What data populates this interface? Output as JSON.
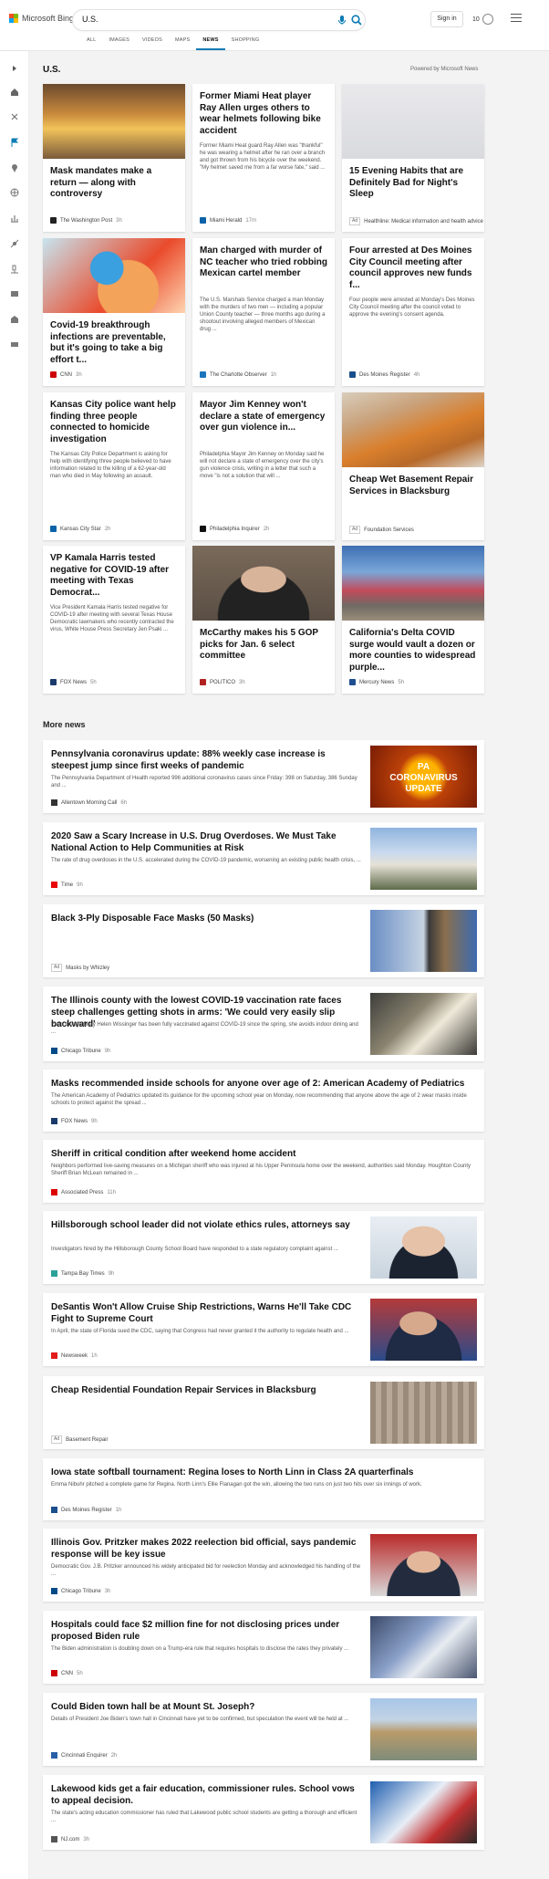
{
  "header": {
    "logo_text": "Microsoft Bing",
    "search_query": "U.S.",
    "sign_in": "Sign in",
    "rewards_points": "10",
    "tabs": [
      {
        "label": "ALL",
        "active": false
      },
      {
        "label": "IMAGES",
        "active": false
      },
      {
        "label": "VIDEOS",
        "active": false
      },
      {
        "label": "MAPS",
        "active": false
      },
      {
        "label": "NEWS",
        "active": true
      },
      {
        "label": "SHOPPING",
        "active": false
      }
    ],
    "accent": "#0c7bb5"
  },
  "sidebar_icons": [
    "expand-icon",
    "home-icon",
    "discover-icon",
    "flag-icon",
    "location-icon",
    "globe-icon",
    "chart-icon",
    "science-icon",
    "microscope-icon",
    "video-icon",
    "building-icon",
    "money-icon"
  ],
  "section": {
    "title": "U.S.",
    "powered_by": "Powered by Microsoft News"
  },
  "cards": [
    {
      "title": "Mask mandates make a return — along with controversy",
      "snippet": "",
      "source": "The Washington Post",
      "age": "3h",
      "ad": false
    },
    {
      "title": "Former Miami Heat player Ray Allen urges others to wear helmets following bike accident",
      "snippet": "Former Miami Heat guard Ray Allen was \"thankful\" he was wearing a helmet after he ran over a branch and got thrown from his bicycle over the weekend. \"My helmet saved me from a far worse fate,\" said ...",
      "source": "Miami Herald",
      "age": "17m",
      "ad": false
    },
    {
      "title": "15 Evening Habits that are Definitely Bad for Night's Sleep",
      "snippet": "",
      "source": "Healthline: Medical information and health advice",
      "age": "",
      "ad": true
    },
    {
      "title": "Covid-19 breakthrough infections are preventable, but it's going to take a big effort t...",
      "snippet": "",
      "source": "CNN",
      "age": "3h",
      "ad": false
    },
    {
      "title": "Man charged with murder of NC teacher who tried robbing Mexican cartel member",
      "snippet": "The U.S. Marshals Service charged a man Monday with the murders of two men — including a popular Union County teacher — three months ago during a shootout involving alleged members of Mexican drug ...",
      "source": "The Charlotte Observer",
      "age": "1h",
      "ad": false
    },
    {
      "title": "Four arrested at Des Moines City Council meeting after council approves new funds f...",
      "snippet": "Four people were arrested at Monday's Des Moines City Council meeting after the council voted to approve the evening's consent agenda.",
      "source": "Des Moines Register",
      "age": "4h",
      "ad": false
    },
    {
      "title": "Kansas City police want help finding three people connected to homicide investigation",
      "snippet": "The Kansas City Police Department is asking for help with identifying three people believed to have information related to the killing of a 62-year-old man who died in May following an assault.",
      "source": "Kansas City Star",
      "age": "2h",
      "ad": false
    },
    {
      "title": "Mayor Jim Kenney won't declare a state of emergency over gun violence in...",
      "snippet": "Philadelphia Mayor Jim Kenney on Monday said he will not declare a state of emergency over the city's gun violence crisis, writing in a letter that such a move \"is not a solution that will ...",
      "source": "Philadelphia Inquirer",
      "age": "2h",
      "ad": false
    },
    {
      "title": "Cheap Wet Basement Repair Services in Blacksburg",
      "snippet": "",
      "source": "Foundation Services",
      "age": "",
      "ad": true
    },
    {
      "title": "VP Kamala Harris tested negative for COVID-19 after meeting with Texas Democrat...",
      "snippet": "Vice President Kamala Harris tested negative for COVID-19 after meeting with several Texas House Democratic lawmakers who recently contracted the virus, White House Press Secretary Jen Psaki ...",
      "source": "FOX News",
      "age": "5h",
      "ad": false
    },
    {
      "title": "McCarthy makes his 5 GOP picks for Jan. 6 select committee",
      "snippet": "",
      "source": "POLITICO",
      "age": "3h",
      "ad": false
    },
    {
      "title": "California's Delta COVID surge would vault a dozen or more counties to widespread purple...",
      "snippet": "",
      "source": "Mercury News",
      "age": "5h",
      "ad": false
    }
  ],
  "more_news": {
    "title": "More news",
    "items": [
      {
        "title": "Pennsylvania coronavirus update: 88% weekly case increase is steepest jump since first weeks of pandemic",
        "snippet": "The Pennsylvania Department of Health reported 996 additional coronavirus cases since Friday: 398 on Saturday, 386 Sunday and ...",
        "source": "Allentown Morning Call",
        "age": "6h",
        "ad": false,
        "image_text": "PA CORONAVIRUS UPDATE"
      },
      {
        "title": "2020 Saw a Scary Increase in U.S. Drug Overdoses. We Must Take National Action to Help Communities at Risk",
        "snippet": "The rate of drug overdoses in the U.S. accelerated during the COVID-19 pandemic, worsening an existing public health crisis, ...",
        "source": "Time",
        "age": "9h",
        "ad": false
      },
      {
        "title": "Black 3-Ply Disposable Face Masks (50 Masks)",
        "snippet": "",
        "source": "Masks by Whizley",
        "age": "",
        "ad": true
      },
      {
        "title": "The Illinois county with the lowest COVID-19 vaccination rate faces steep challenges getting shots in arms: 'We could very easily slip backward'",
        "snippet": "Even though Mary Helen Wissinger has been fully vaccinated against COVID-19 since the spring, she avoids indoor dining and ...",
        "source": "Chicago Tribune",
        "age": "9h",
        "ad": false
      },
      {
        "title": "Masks recommended inside schools for anyone over age of 2: American Academy of Pediatrics",
        "snippet": "The American Academy of Pediatrics updated its guidance for the upcoming school year on Monday, now recommending that anyone above the age of 2 wear masks inside schools to protect against the spread ...",
        "source": "FOX News",
        "age": "9h",
        "ad": false
      },
      {
        "title": "Sheriff in critical condition after weekend home accident",
        "snippet": "Neighbors performed live-saving measures on a Michigan sheriff who was injured at his Upper Peninsula home over the weekend, authorities said Monday. Houghton County Sheriff Brian McLean remained in ...",
        "source": "Associated Press",
        "age": "11h",
        "ad": false
      },
      {
        "title": "Hillsborough school leader did not violate ethics rules, attorneys say",
        "snippet": "Investigators hired by the Hillsborough County School Board have responded to a state regulatory complaint against ...",
        "source": "Tampa Bay Times",
        "age": "9h",
        "ad": false
      },
      {
        "title": "DeSantis Won't Allow Cruise Ship Restrictions, Warns He'll Take CDC Fight to Supreme Court",
        "snippet": "In April, the state of Florida sued the CDC, saying that Congress had never granted it the authority to regulate health and ...",
        "source": "Newsweek",
        "age": "1h",
        "ad": false
      },
      {
        "title": "Cheap Residential Foundation Repair Services in Blacksburg",
        "snippet": "",
        "source": "Basement Repair",
        "age": "",
        "ad": true
      },
      {
        "title": "Iowa state softball tournament: Regina loses to North Linn in Class 2A quarterfinals",
        "snippet": "Emma Nibuhr pitched a complete game for Regina. North Linn's Ellie Flanagan got the win, allowing the two runs on just two hits over six innings of work.",
        "source": "Des Moines Register",
        "age": "1h",
        "ad": false
      },
      {
        "title": "Illinois Gov. Pritzker makes 2022 reelection bid official, says pandemic response will be key issue",
        "snippet": "Democratic Gov. J.B. Pritzker announced his widely anticipated bid for reelection Monday and acknowledged his handling of the ...",
        "source": "Chicago Tribune",
        "age": "3h",
        "ad": false
      },
      {
        "title": "Hospitals could face $2 million fine for not disclosing prices under proposed Biden rule",
        "snippet": "The Biden administration is doubling down on a Trump-era rule that requires hospitals to disclose the rates they privately ...",
        "source": "CNN",
        "age": "5h",
        "ad": false
      },
      {
        "title": "Could Biden town hall be at Mount St. Joseph?",
        "snippet": "Details of President Joe Biden's town hall in Cincinnati have yet to be confirmed, but speculation the event will be held at ...",
        "source": "Cincinnati Enquirer",
        "age": "2h",
        "ad": false
      },
      {
        "title": "Lakewood kids get a fair education, commissioner rules. School vows to appeal decision.",
        "snippet": "The state's acting education commissioner has ruled that Lakewood public school students are getting a thorough and efficient ...",
        "source": "NJ.com",
        "age": "3h",
        "ad": false
      }
    ]
  },
  "ad_label": "Ad"
}
